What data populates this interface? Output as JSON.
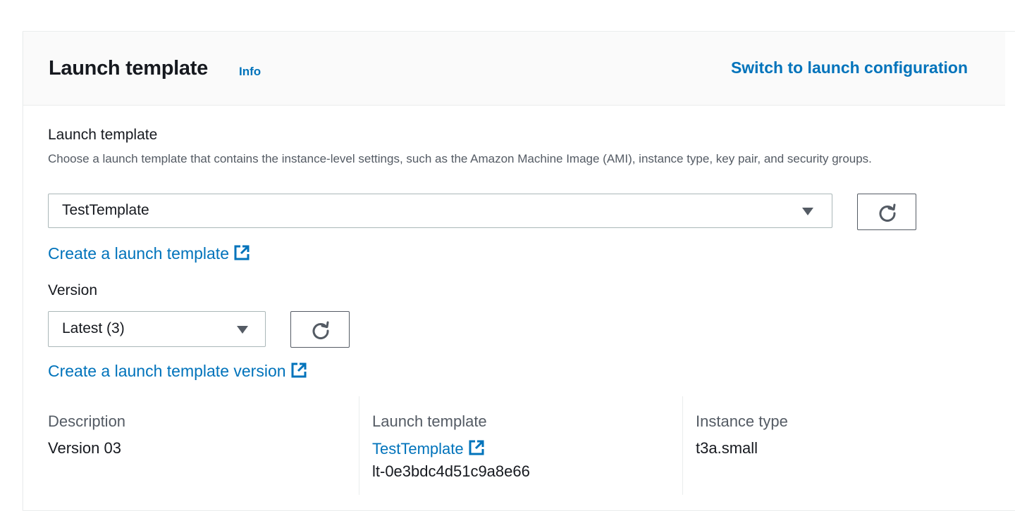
{
  "header": {
    "title": "Launch template",
    "info_label": "Info",
    "switch_label": "Switch to launch configuration"
  },
  "launch_template_field": {
    "label": "Launch template",
    "description": "Choose a launch template that contains the instance-level settings, such as the Amazon Machine Image (AMI), instance type, key pair, and security groups.",
    "selected": "TestTemplate",
    "create_link": "Create a launch template"
  },
  "version_field": {
    "label": "Version",
    "selected": "Latest (3)",
    "create_link": "Create a launch template version"
  },
  "summary": {
    "description": {
      "label": "Description",
      "value": "Version 03"
    },
    "launch_template": {
      "label": "Launch template",
      "link": "TestTemplate",
      "id": "lt-0e3bdc4d51c9a8e66"
    },
    "instance_type": {
      "label": "Instance type",
      "value": "t3a.small"
    }
  },
  "icons": {
    "caret": "caret-down-icon",
    "refresh": "refresh-icon",
    "external": "external-link-icon"
  },
  "colors": {
    "link": "#0073bb",
    "text": "#16191f",
    "muted": "#545b64",
    "header_bg": "#fafafa"
  }
}
